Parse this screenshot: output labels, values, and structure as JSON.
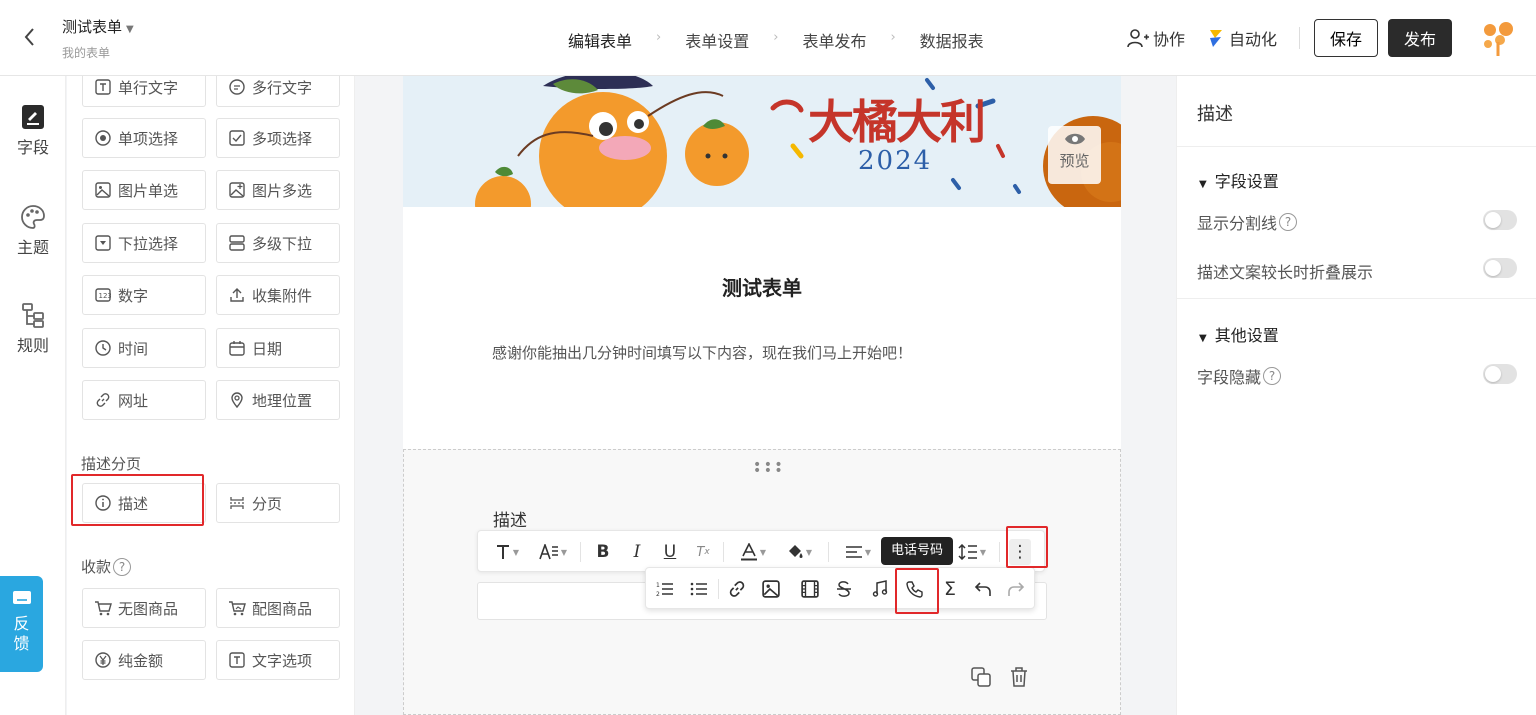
{
  "header": {
    "title": "测试表单",
    "subtitle": "我的表单",
    "steps": [
      "编辑表单",
      "表单设置",
      "表单发布",
      "数据报表"
    ],
    "active_step": 0,
    "collab_label": "协作",
    "automation_label": "自动化",
    "save_label": "保存",
    "publish_label": "发布"
  },
  "leftnav": {
    "items": [
      {
        "label": "字段",
        "icon": "edit-icon"
      },
      {
        "label": "主题",
        "icon": "palette-icon"
      },
      {
        "label": "规则",
        "icon": "rules-icon"
      }
    ]
  },
  "feedback_label": "反馈",
  "palette": {
    "fields": [
      {
        "label": "单行文字",
        "icon": "text-icon"
      },
      {
        "label": "多行文字",
        "icon": "comment-icon"
      },
      {
        "label": "单项选择",
        "icon": "radio-icon"
      },
      {
        "label": "多项选择",
        "icon": "checkbox-icon"
      },
      {
        "label": "图片单选",
        "icon": "image-icon"
      },
      {
        "label": "图片多选",
        "icon": "images-icon"
      },
      {
        "label": "下拉选择",
        "icon": "dropdown-icon"
      },
      {
        "label": "多级下拉",
        "icon": "cascade-icon"
      },
      {
        "label": "数字",
        "icon": "number-icon"
      },
      {
        "label": "收集附件",
        "icon": "upload-icon"
      },
      {
        "label": "时间",
        "icon": "clock-icon"
      },
      {
        "label": "日期",
        "icon": "calendar-icon"
      },
      {
        "label": "网址",
        "icon": "link-icon"
      },
      {
        "label": "地理位置",
        "icon": "location-icon"
      }
    ],
    "section_desc": "描述分页",
    "desc_items": [
      {
        "label": "描述",
        "icon": "info-icon"
      },
      {
        "label": "分页",
        "icon": "pagebreak-icon"
      }
    ],
    "section_pay": "收款",
    "pay_items": [
      {
        "label": "无图商品",
        "icon": "cart-icon"
      },
      {
        "label": "配图商品",
        "icon": "cart-image-icon"
      },
      {
        "label": "纯金额",
        "icon": "yen-icon"
      },
      {
        "label": "文字选项",
        "icon": "text-option-icon"
      }
    ]
  },
  "canvas": {
    "preview_label": "预览",
    "banner_text": "大橘大利",
    "banner_year": "2024",
    "form_title": "测试表单",
    "form_desc": "感谢你能抽出几分钟时间填写以下内容，现在我们马上开始吧！",
    "block_label": "描述",
    "tooltip": "电话号码"
  },
  "right": {
    "title": "描述",
    "section1": "字段设置",
    "opt1": "显示分割线",
    "opt2": "描述文案较长时折叠展示",
    "section2": "其他设置",
    "opt3": "字段隐藏"
  },
  "colors": {
    "accent": "#f28a2e",
    "highlight": "#e1282a",
    "feedback": "#2aa7e0"
  }
}
